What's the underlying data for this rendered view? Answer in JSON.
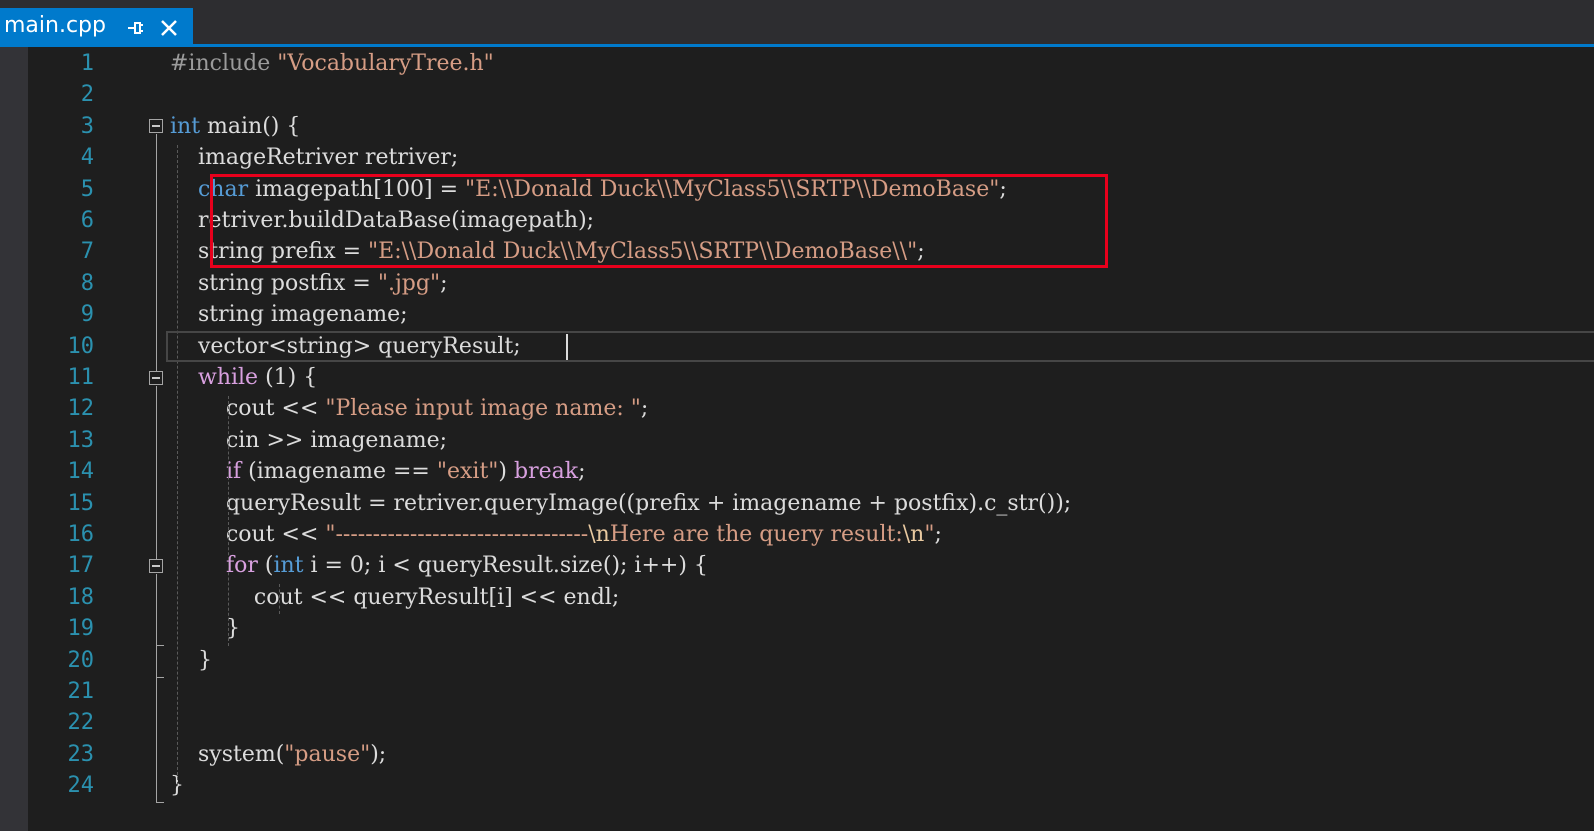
{
  "tab": {
    "title": "main.cpp",
    "pin_icon": "pin-icon",
    "close_icon": "close-icon"
  },
  "lines": [
    {
      "n": "1",
      "tokens": [
        {
          "c": "pp",
          "t": "#include "
        },
        {
          "c": "str",
          "t": "\"VocabularyTree.h\""
        }
      ]
    },
    {
      "n": "2",
      "tokens": []
    },
    {
      "n": "3",
      "tokens": [
        {
          "c": "kw",
          "t": "int"
        },
        {
          "c": "plain",
          "t": " main() {"
        }
      ]
    },
    {
      "n": "4",
      "tokens": [
        {
          "c": "plain",
          "t": "    imageRetriver retriver;"
        }
      ]
    },
    {
      "n": "5",
      "tokens": [
        {
          "c": "plain",
          "t": "    "
        },
        {
          "c": "kw",
          "t": "char"
        },
        {
          "c": "plain",
          "t": " imagepath[100] = "
        },
        {
          "c": "str",
          "t": "\"E:\\\\Donald Duck\\\\MyClass5\\\\SRTP\\\\DemoBase\""
        },
        {
          "c": "plain",
          "t": ";"
        }
      ]
    },
    {
      "n": "6",
      "tokens": [
        {
          "c": "plain",
          "t": "    retriver.buildDataBase(imagepath);"
        }
      ]
    },
    {
      "n": "7",
      "tokens": [
        {
          "c": "plain",
          "t": "    string prefix = "
        },
        {
          "c": "str",
          "t": "\"E:\\\\Donald Duck\\\\MyClass5\\\\SRTP\\\\DemoBase\\\\\""
        },
        {
          "c": "plain",
          "t": ";"
        }
      ]
    },
    {
      "n": "8",
      "tokens": [
        {
          "c": "plain",
          "t": "    string postfix = "
        },
        {
          "c": "str",
          "t": "\".jpg\""
        },
        {
          "c": "plain",
          "t": ";"
        }
      ]
    },
    {
      "n": "9",
      "tokens": [
        {
          "c": "plain",
          "t": "    string imagename;"
        }
      ]
    },
    {
      "n": "10",
      "tokens": [
        {
          "c": "plain",
          "t": "    vector<string> queryResult;"
        }
      ]
    },
    {
      "n": "11",
      "tokens": [
        {
          "c": "plain",
          "t": "    "
        },
        {
          "c": "flow",
          "t": "while"
        },
        {
          "c": "plain",
          "t": " (1) {"
        }
      ]
    },
    {
      "n": "12",
      "tokens": [
        {
          "c": "plain",
          "t": "        cout << "
        },
        {
          "c": "str",
          "t": "\"Please input image name: \""
        },
        {
          "c": "plain",
          "t": ";"
        }
      ]
    },
    {
      "n": "13",
      "tokens": [
        {
          "c": "plain",
          "t": "        cin >> imagename;"
        }
      ]
    },
    {
      "n": "14",
      "tokens": [
        {
          "c": "plain",
          "t": "        "
        },
        {
          "c": "flow",
          "t": "if"
        },
        {
          "c": "plain",
          "t": " (imagename == "
        },
        {
          "c": "str",
          "t": "\"exit\""
        },
        {
          "c": "plain",
          "t": ") "
        },
        {
          "c": "flow",
          "t": "break"
        },
        {
          "c": "plain",
          "t": ";"
        }
      ]
    },
    {
      "n": "15",
      "tokens": [
        {
          "c": "plain",
          "t": "        queryResult = retriver.queryImage((prefix + imagename + postfix).c_str());"
        }
      ]
    },
    {
      "n": "16",
      "tokens": [
        {
          "c": "plain",
          "t": "        cout << "
        },
        {
          "c": "str",
          "t": "\"----------------------------------"
        },
        {
          "c": "esc",
          "t": "\\n"
        },
        {
          "c": "str",
          "t": "Here are the query result:"
        },
        {
          "c": "esc",
          "t": "\\n"
        },
        {
          "c": "str",
          "t": "\""
        },
        {
          "c": "plain",
          "t": ";"
        }
      ]
    },
    {
      "n": "17",
      "tokens": [
        {
          "c": "plain",
          "t": "        "
        },
        {
          "c": "flow",
          "t": "for"
        },
        {
          "c": "plain",
          "t": " ("
        },
        {
          "c": "kw",
          "t": "int"
        },
        {
          "c": "plain",
          "t": " i = 0; i < queryResult.size(); i++) {"
        }
      ]
    },
    {
      "n": "18",
      "tokens": [
        {
          "c": "plain",
          "t": "            cout << queryResult[i] << endl;"
        }
      ]
    },
    {
      "n": "19",
      "tokens": [
        {
          "c": "plain",
          "t": "        }"
        }
      ]
    },
    {
      "n": "20",
      "tokens": [
        {
          "c": "plain",
          "t": "    }"
        }
      ]
    },
    {
      "n": "21",
      "tokens": []
    },
    {
      "n": "22",
      "tokens": []
    },
    {
      "n": "23",
      "tokens": [
        {
          "c": "plain",
          "t": "    system("
        },
        {
          "c": "str",
          "t": "\"pause\""
        },
        {
          "c": "plain",
          "t": ");"
        }
      ]
    },
    {
      "n": "24",
      "tokens": [
        {
          "c": "plain",
          "t": "}"
        }
      ]
    }
  ],
  "colors": {
    "accent": "#007acc",
    "highlight_box": "#e8001c",
    "keyword": "#569cd6",
    "string": "#d69d85",
    "control_flow": "#d8a0df",
    "line_number": "#2b91af"
  }
}
